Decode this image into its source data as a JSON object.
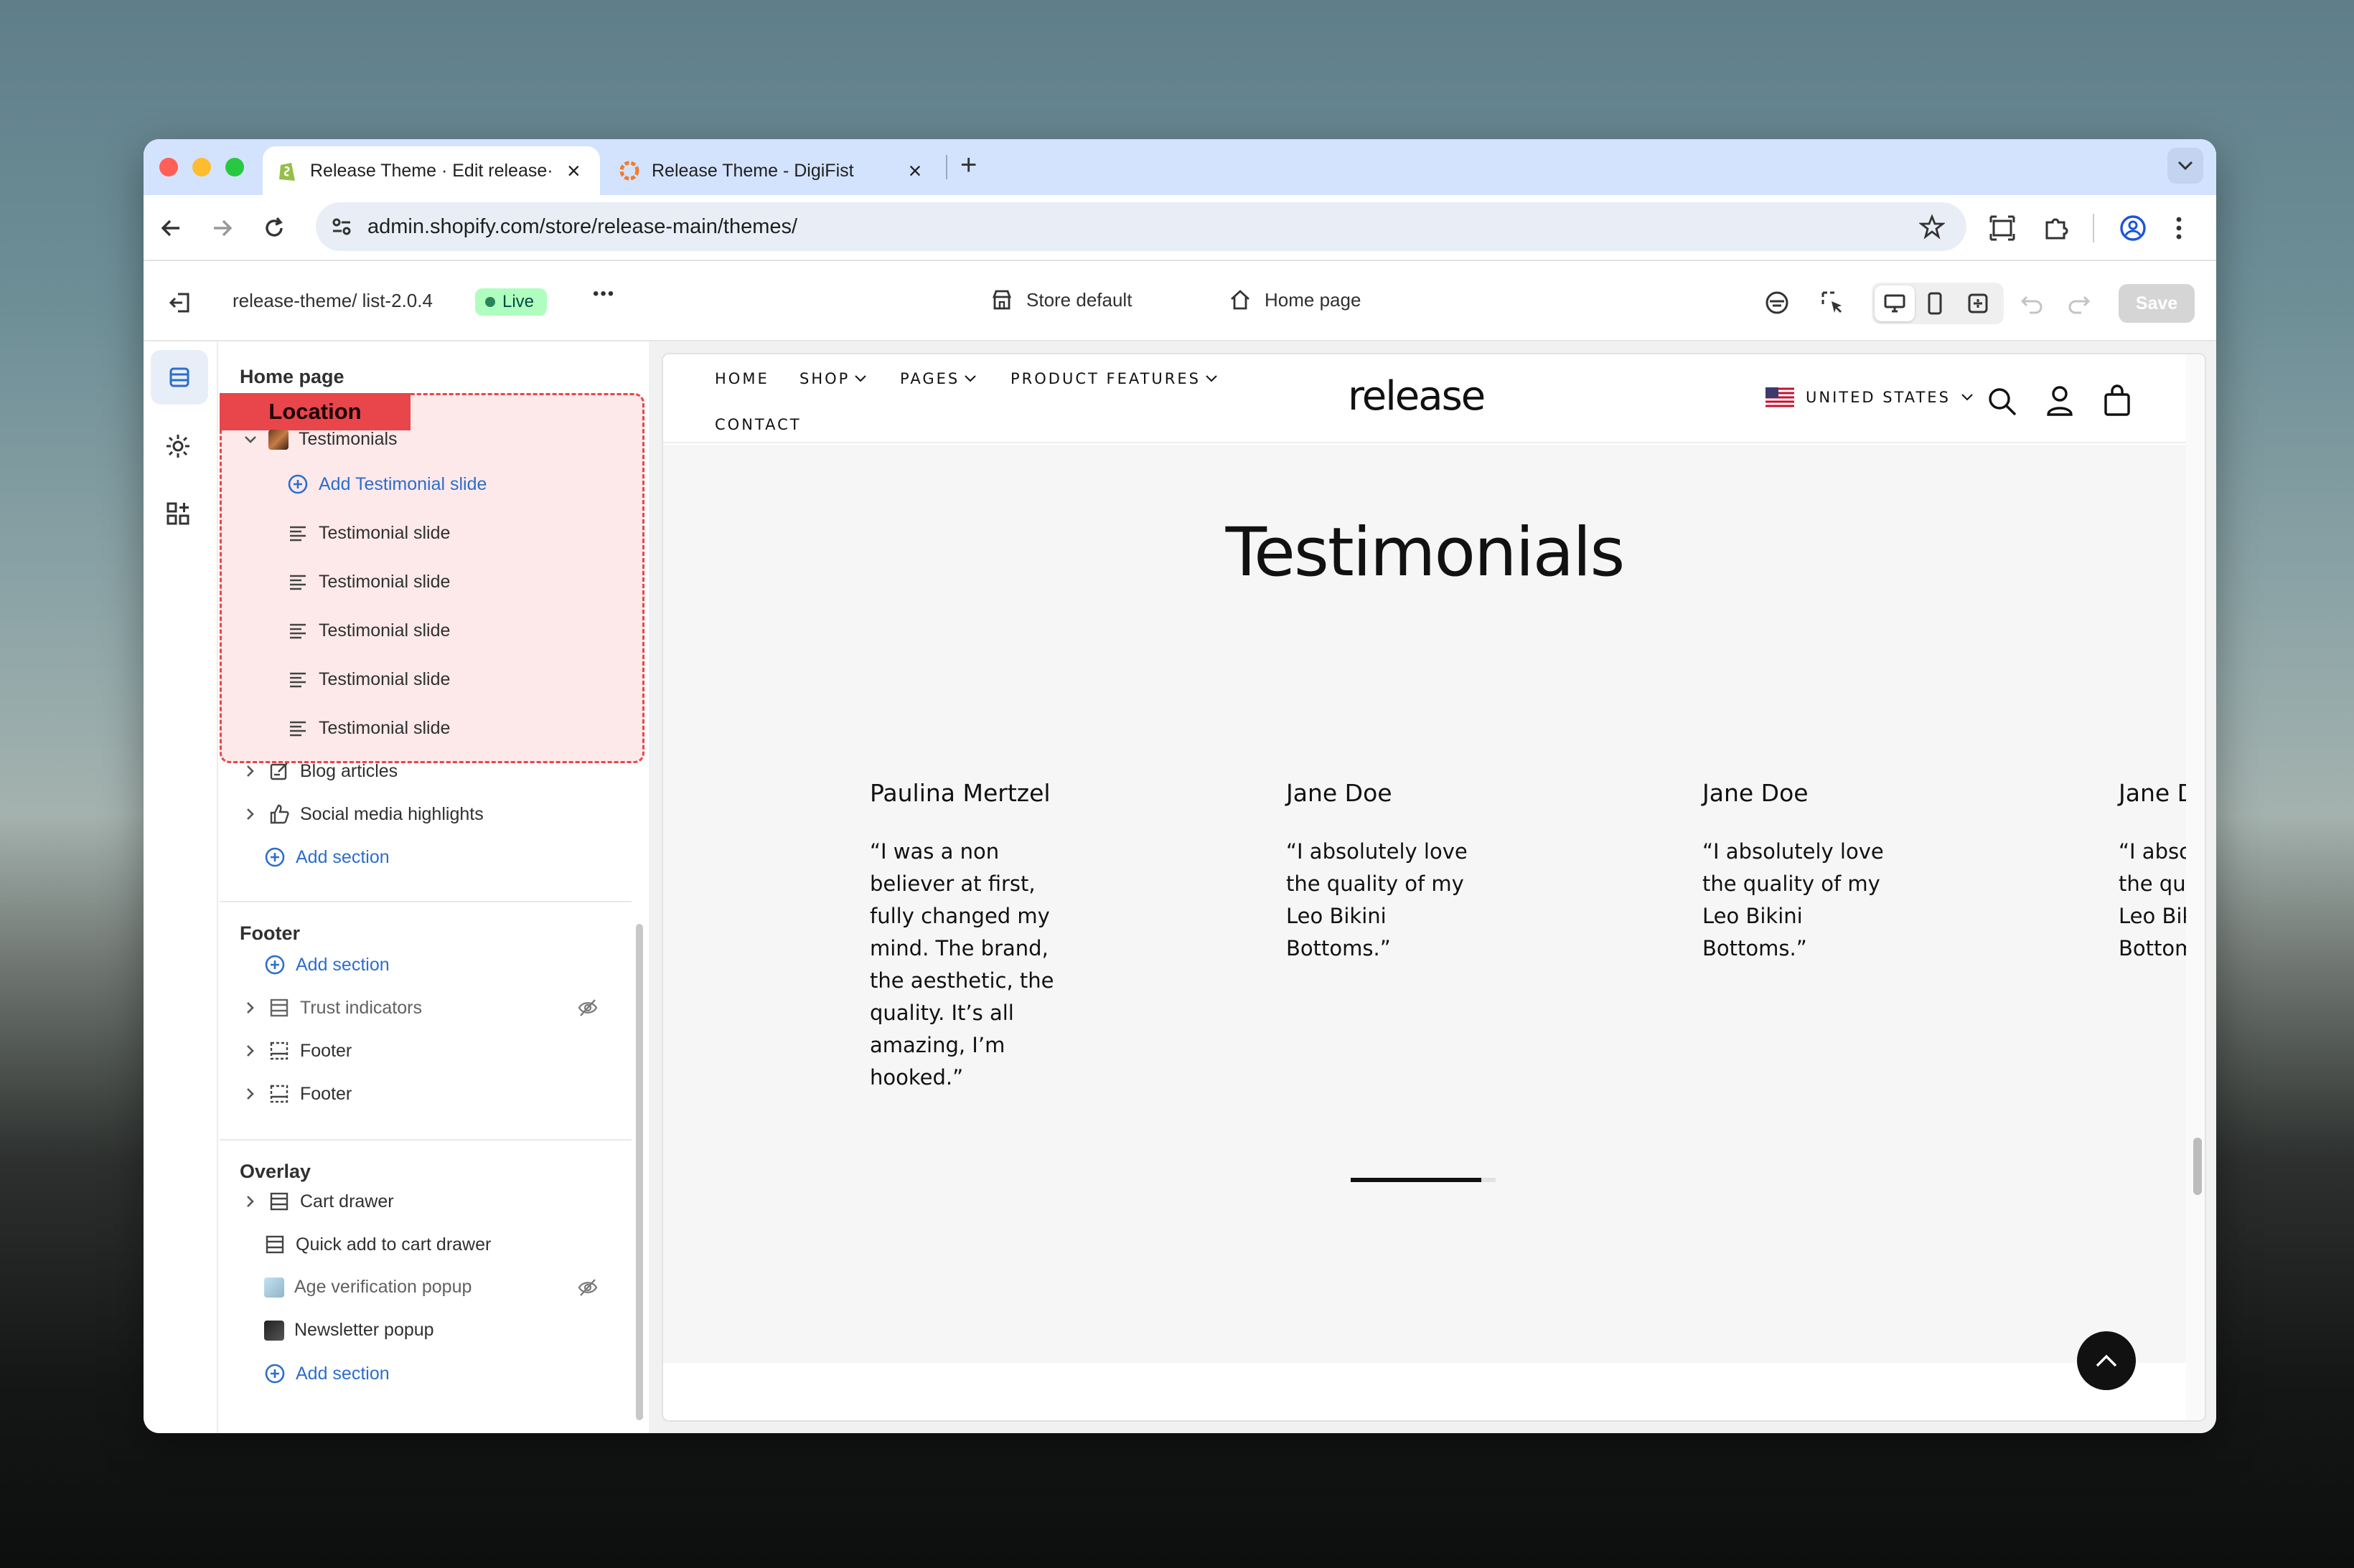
{
  "browser": {
    "tabs": [
      {
        "label": "Release Theme · Edit release·",
        "close": "×"
      },
      {
        "label": "Release Theme - DigiFist",
        "close": "×"
      }
    ],
    "new_tab": "+",
    "url": "admin.shopify.com/store/release-main/themes/"
  },
  "topbar": {
    "theme_name": "release-theme/ list-2.0.4",
    "live_badge": "Live",
    "more": "•••",
    "store_default": "Store default",
    "page_select": "Home page",
    "save_label": "Save"
  },
  "panel": {
    "section_title": "Home page",
    "annotation": "Location",
    "testimonials": {
      "label": "Testimonials",
      "add_slide": "Add Testimonial slide",
      "slides": [
        "Testimonial slide",
        "Testimonial slide",
        "Testimonial slide",
        "Testimonial slide",
        "Testimonial slide"
      ]
    },
    "blog_articles": "Blog articles",
    "social_media": "Social media highlights",
    "add_section": "Add section",
    "footer_title": "Footer",
    "footer_add": "Add section",
    "footer_items": [
      "Trust indicators",
      "Footer",
      "Footer"
    ],
    "overlay_title": "Overlay",
    "overlay_items": [
      "Cart drawer",
      "Quick add to cart drawer",
      "Age verification popup",
      "Newsletter popup"
    ],
    "overlay_add": "Add section"
  },
  "store": {
    "nav": {
      "home": "HOME",
      "shop": "SHOP",
      "pages": "PAGES",
      "product_features": "PRODUCT FEATURES",
      "contact": "CONTACT"
    },
    "logo": "release",
    "country": "UNITED STATES",
    "heading": "Testimonials",
    "testimonials": [
      {
        "name": "Paulina Mertzel",
        "quote": "“I was a non believer at first, fully changed my mind. The brand, the aesthetic, the quality. It’s all amazing, I’m hooked.”"
      },
      {
        "name": "Jane Doe",
        "quote": "“I absolutely love the quality of my Leo Bikini Bottoms.”"
      },
      {
        "name": "Jane Doe",
        "quote": "“I absolutely love the quality of my Leo Bikini Bottoms.”"
      },
      {
        "name": "Jane D",
        "quote": "“I absolutely love the quality of my Leo Bikini Bottoms.”"
      }
    ],
    "slider_progress": 0.9
  },
  "colors": {
    "accent_blue": "#2c6ecb",
    "annotation_red": "#e8464a",
    "live_green": "#affebf"
  }
}
